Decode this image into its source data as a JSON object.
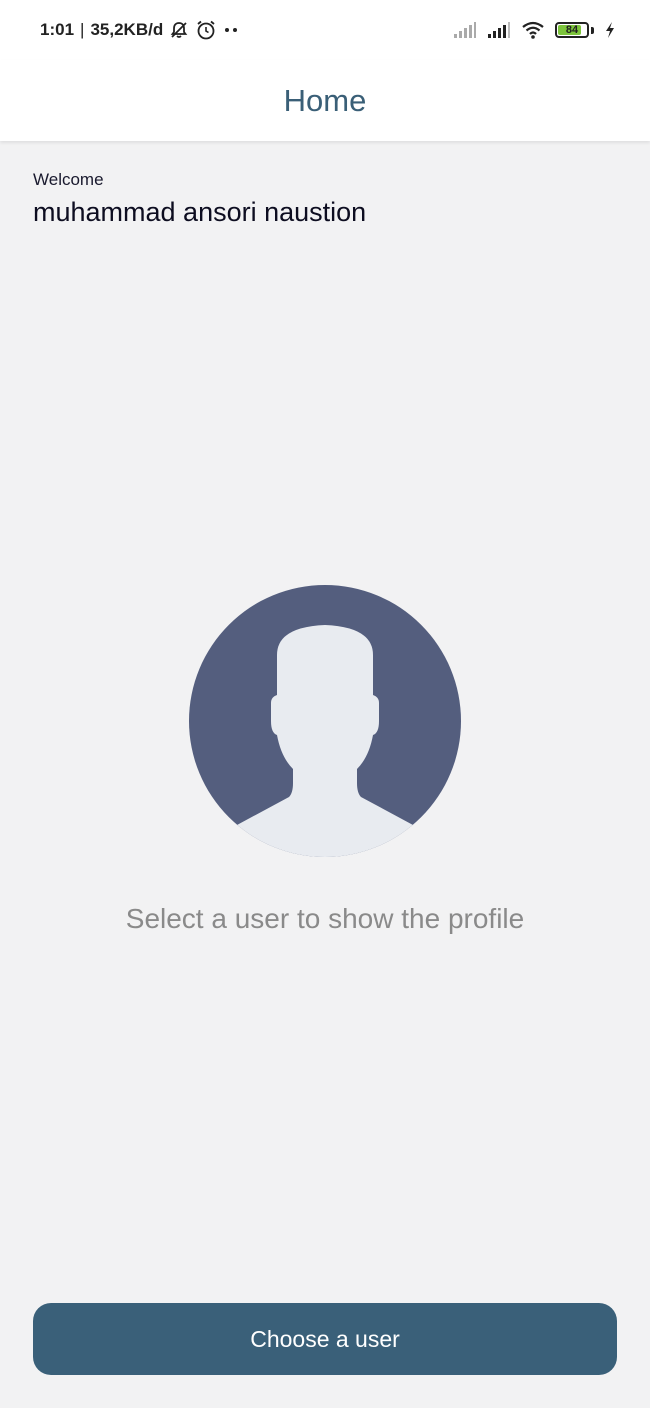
{
  "status_bar": {
    "time": "1:01",
    "separator": "|",
    "network_speed": "35,2KB/d",
    "icons": [
      "notifications-off-icon",
      "alarm-icon",
      "more-dots-icon",
      "signal-icon",
      "signal-icon",
      "wifi-icon",
      "battery-icon",
      "charging-icon"
    ],
    "battery_level": "84",
    "battery_fraction": 0.84,
    "battery_color": "#7cc43b"
  },
  "app_bar": {
    "title": "Home"
  },
  "greeting": {
    "label": "Welcome",
    "name": "muhammad ansori naustion"
  },
  "empty_state": {
    "icon": "user-avatar-placeholder",
    "message": "Select a user to show the profile"
  },
  "actions": {
    "choose_user_label": "Choose a user"
  },
  "colors": {
    "accent": "#3a6079",
    "title": "#3a5f77",
    "avatar_bg": "#545e7e",
    "avatar_silhouette": "#e8ebf0",
    "background": "#f2f2f3"
  }
}
